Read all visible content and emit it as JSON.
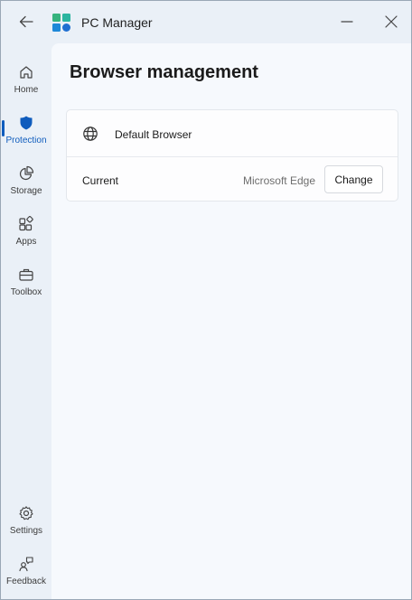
{
  "app": {
    "title": "PC Manager",
    "accent_color": "#0f5cbd"
  },
  "titlebar": {
    "back_icon": "arrow-left-icon",
    "minimize_icon": "minimize-icon",
    "close_icon": "close-icon"
  },
  "sidebar": {
    "items": [
      {
        "label": "Home",
        "icon": "home-icon",
        "active": false
      },
      {
        "label": "Protection",
        "icon": "shield-icon",
        "active": true
      },
      {
        "label": "Storage",
        "icon": "pie-chart-icon",
        "active": false
      },
      {
        "label": "Apps",
        "icon": "apps-grid-icon",
        "active": false
      },
      {
        "label": "Toolbox",
        "icon": "toolbox-icon",
        "active": false
      }
    ],
    "bottom_items": [
      {
        "label": "Settings",
        "icon": "gear-icon"
      },
      {
        "label": "Feedback",
        "icon": "feedback-icon"
      }
    ]
  },
  "main": {
    "page_title": "Browser management",
    "card": {
      "icon": "globe-icon",
      "title": "Default Browser",
      "row_label": "Current",
      "row_value": "Microsoft Edge",
      "button_label": "Change"
    }
  }
}
